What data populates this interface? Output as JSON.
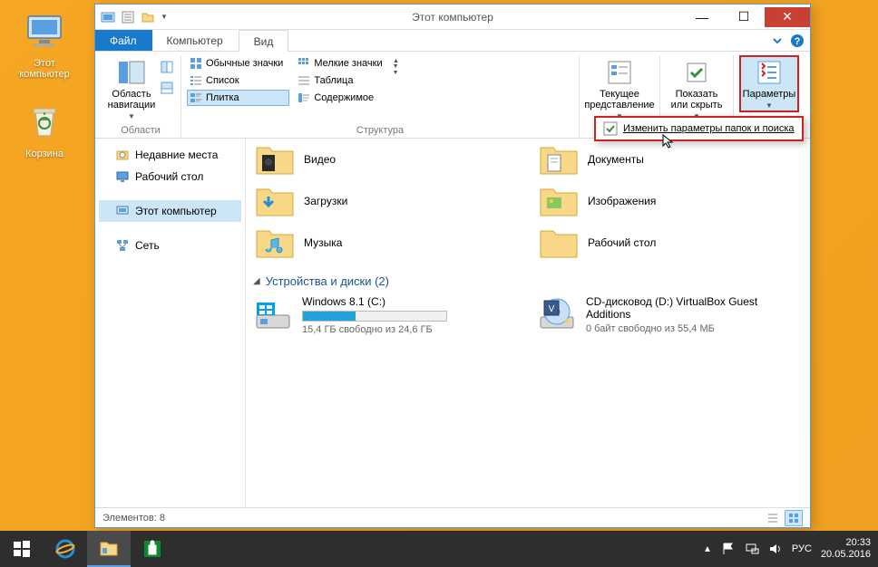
{
  "desktop": {
    "icons": [
      {
        "label": "Этот компьютер"
      },
      {
        "label": "Корзина"
      }
    ]
  },
  "window": {
    "title": "Этот компьютер",
    "tabs": {
      "file": "Файл",
      "computer": "Компьютер",
      "view": "Вид"
    },
    "ribbon": {
      "groups": {
        "navpane": {
          "label": "Области",
          "btn": "Область навигации"
        },
        "layout": {
          "label": "Структура",
          "items": [
            "Обычные значки",
            "Мелкие значки",
            "Список",
            "Таблица",
            "Плитка",
            "Содержимое"
          ]
        },
        "current": {
          "label": "Текущее представление"
        },
        "showhide": {
          "label": "Показать или скрыть"
        },
        "options": {
          "label": "Параметры"
        }
      }
    },
    "popup": "Изменить параметры папок и поиска",
    "nav": {
      "recent": "Недавние места",
      "desktop": "Рабочий стол",
      "thispc": "Этот компьютер",
      "network": "Сеть"
    },
    "folders": [
      "Видео",
      "Документы",
      "Загрузки",
      "Изображения",
      "Музыка",
      "Рабочий стол"
    ],
    "section": "Устройства и диски (2)",
    "drives": [
      {
        "name": "Windows 8.1 (C:)",
        "detail": "15,4 ГБ свободно из 24,6 ГБ",
        "fill": 37
      },
      {
        "name": "CD-дисковод (D:) VirtualBox Guest Additions",
        "detail": "0 байт свободно из 55,4 МБ"
      }
    ],
    "status": "Элементов: 8"
  },
  "taskbar": {
    "lang": "РУС",
    "time": "20:33",
    "date": "20.05.2016"
  }
}
